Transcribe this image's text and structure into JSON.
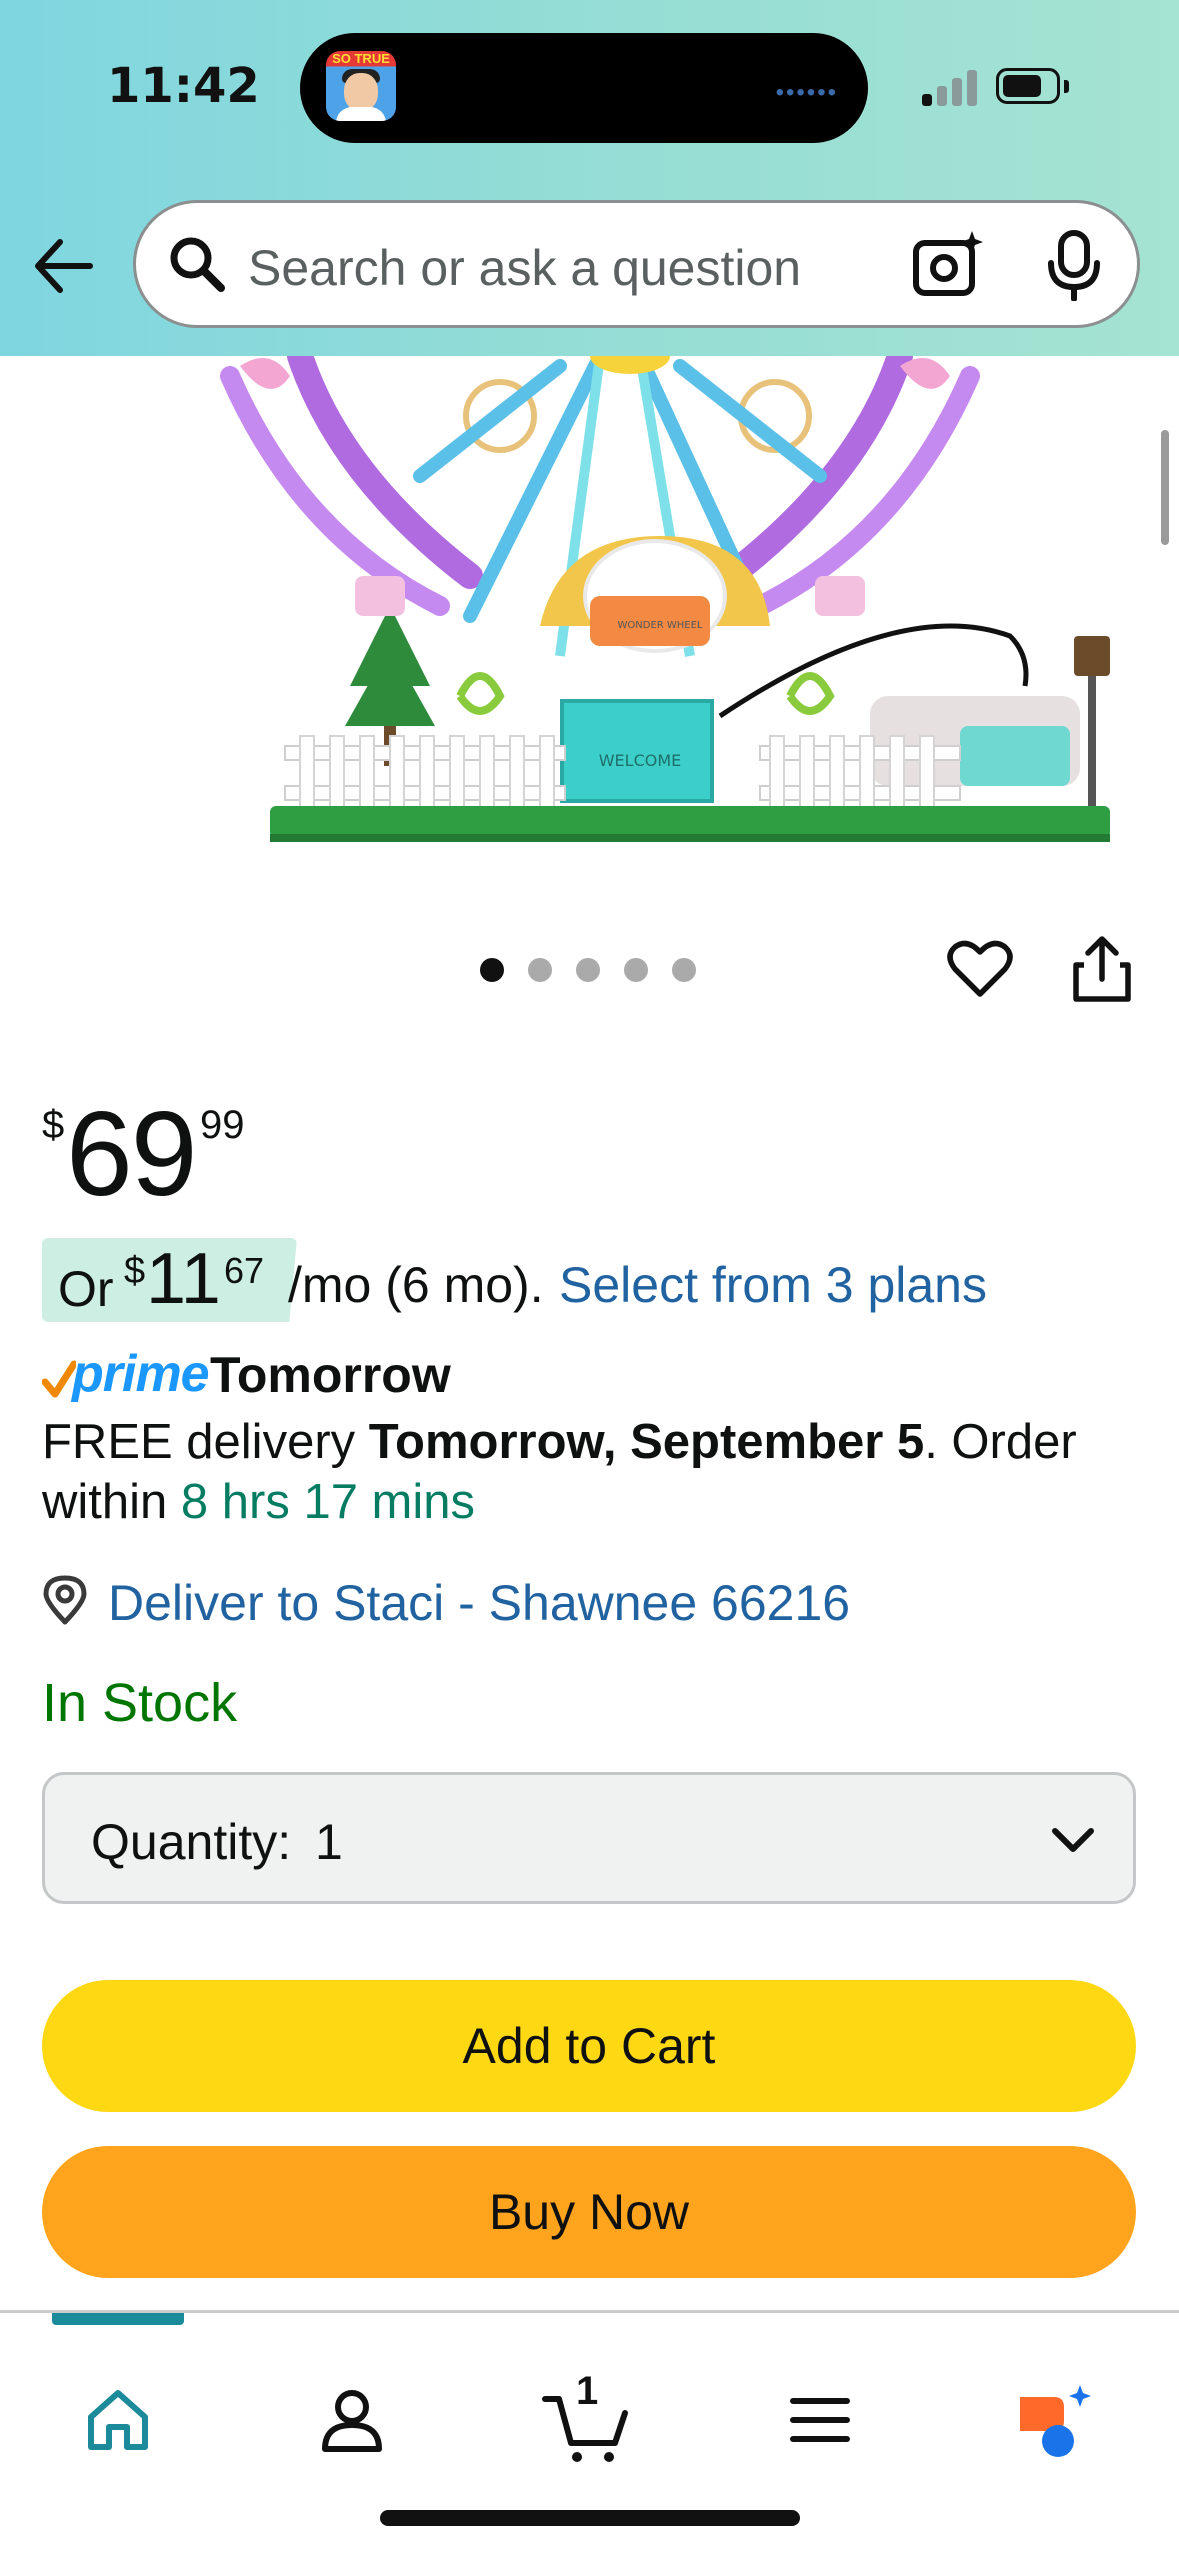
{
  "status_bar": {
    "time": "11:42",
    "island_avatar_text": "SO TRUE"
  },
  "header": {
    "search_placeholder": "Search or ask a question",
    "accent_color": "#7fd6e0"
  },
  "product_image": {
    "sign_text": "WELCOME",
    "badge_text": "WONDER WHEEL",
    "carousel": {
      "count": 5,
      "active_index": 0
    }
  },
  "price": {
    "symbol": "$",
    "whole": "69",
    "fraction": "99"
  },
  "monthly": {
    "or": "Or",
    "symbol": "$",
    "whole": "11",
    "fraction": "67",
    "term": "/mo (6 mo).",
    "plans_link": "Select from 3 plans"
  },
  "prime": {
    "logo": "prime",
    "label": "Tomorrow"
  },
  "delivery": {
    "prefix": "FREE delivery ",
    "date": "Tomorrow, September 5",
    "suffix": ". Order within ",
    "countdown": "8 hrs 17 mins"
  },
  "location": {
    "text": "Deliver to Staci - Shawnee 66216"
  },
  "stock": {
    "text": "In Stock",
    "color": "#007600"
  },
  "quantity": {
    "label": "Quantity:",
    "value": "1"
  },
  "buttons": {
    "add_to_cart": "Add to Cart",
    "buy_now": "Buy Now",
    "add_to_cart_color": "#ffd814",
    "buy_now_color": "#ffa41c"
  },
  "bottom_nav": {
    "items": [
      {
        "icon": "home-icon",
        "active": true
      },
      {
        "icon": "account-icon"
      },
      {
        "icon": "cart-icon",
        "badge": "1"
      },
      {
        "icon": "menu-icon"
      },
      {
        "icon": "rufus-ai-icon"
      }
    ]
  }
}
